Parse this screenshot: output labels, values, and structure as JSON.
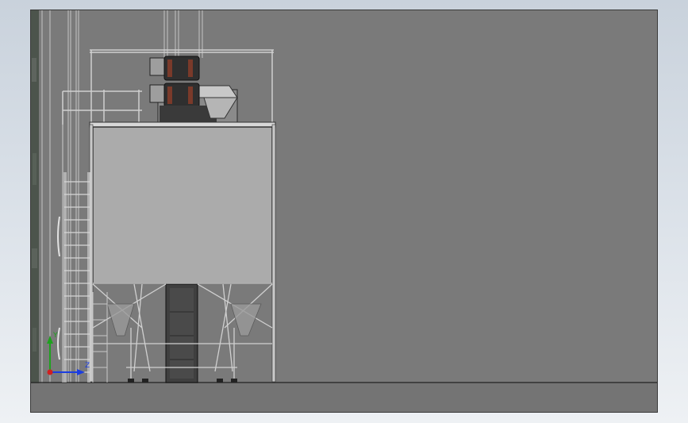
{
  "viewport": {
    "background_color": "#7a7a7a",
    "floor_color": "#747474",
    "rock_wall_color": "#4c544c"
  },
  "triad": {
    "x_label": "Z",
    "y_label": "Y",
    "x_color": "#1b3de0",
    "y_color": "#1ea21e",
    "origin_color": "#d11f1f"
  },
  "model": {
    "hopper_color": "#ababab",
    "frame_color": "#c0c0c0",
    "elevator_color": "#3f3f3f",
    "motor_color": "#2f2f2f"
  }
}
